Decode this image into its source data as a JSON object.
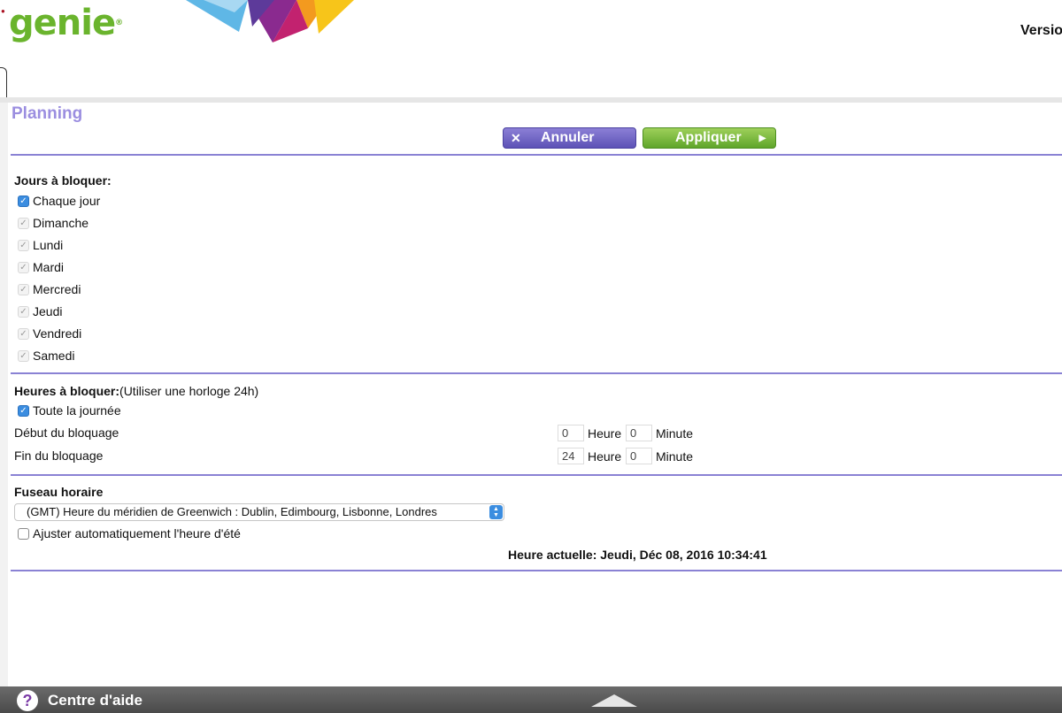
{
  "header": {
    "logo_text": "genie",
    "logo_mark": "®",
    "version_label": "Versio"
  },
  "page": {
    "title": "Planning",
    "cancel_label": "Annuler",
    "apply_label": "Appliquer"
  },
  "days": {
    "label": "Jours à bloquer:",
    "every_day": "Chaque jour",
    "items": [
      "Dimanche",
      "Lundi",
      "Mardi",
      "Mercredi",
      "Jeudi",
      "Vendredi",
      "Samedi"
    ]
  },
  "hours": {
    "label": "Heures à bloquer:",
    "hint": "(Utiliser une horloge 24h)",
    "all_day": "Toute la journée",
    "start_label": "Début du bloquage",
    "end_label": "Fin du bloquage",
    "start_hour": "0",
    "start_minute": "0",
    "end_hour": "24",
    "end_minute": "0",
    "hour_unit": "Heure",
    "minute_unit": "Minute"
  },
  "timezone": {
    "label": "Fuseau horaire",
    "selected": "(GMT) Heure du méridien de Greenwich : Dublin, Edimbourg, Lisbonne, Londres",
    "dst_label": "Ajuster automatiquement l'heure d'été",
    "current_time": "Heure actuelle: Jeudi, Déc 08, 2016 10:34:41"
  },
  "footer": {
    "help_label": "Centre d'aide",
    "help_glyph": "?"
  },
  "icons": {
    "cancel": "close-icon",
    "apply": "arrow-right-icon",
    "help": "help-icon",
    "expand": "chevron-up-icon"
  },
  "colors": {
    "accent": "#8a82d4",
    "title": "#9b8ee0",
    "cancel_button": "#6a5fc4",
    "apply_button": "#7dbb3e",
    "logo": "#6ab42d",
    "checkbox": "#3b8de0"
  }
}
